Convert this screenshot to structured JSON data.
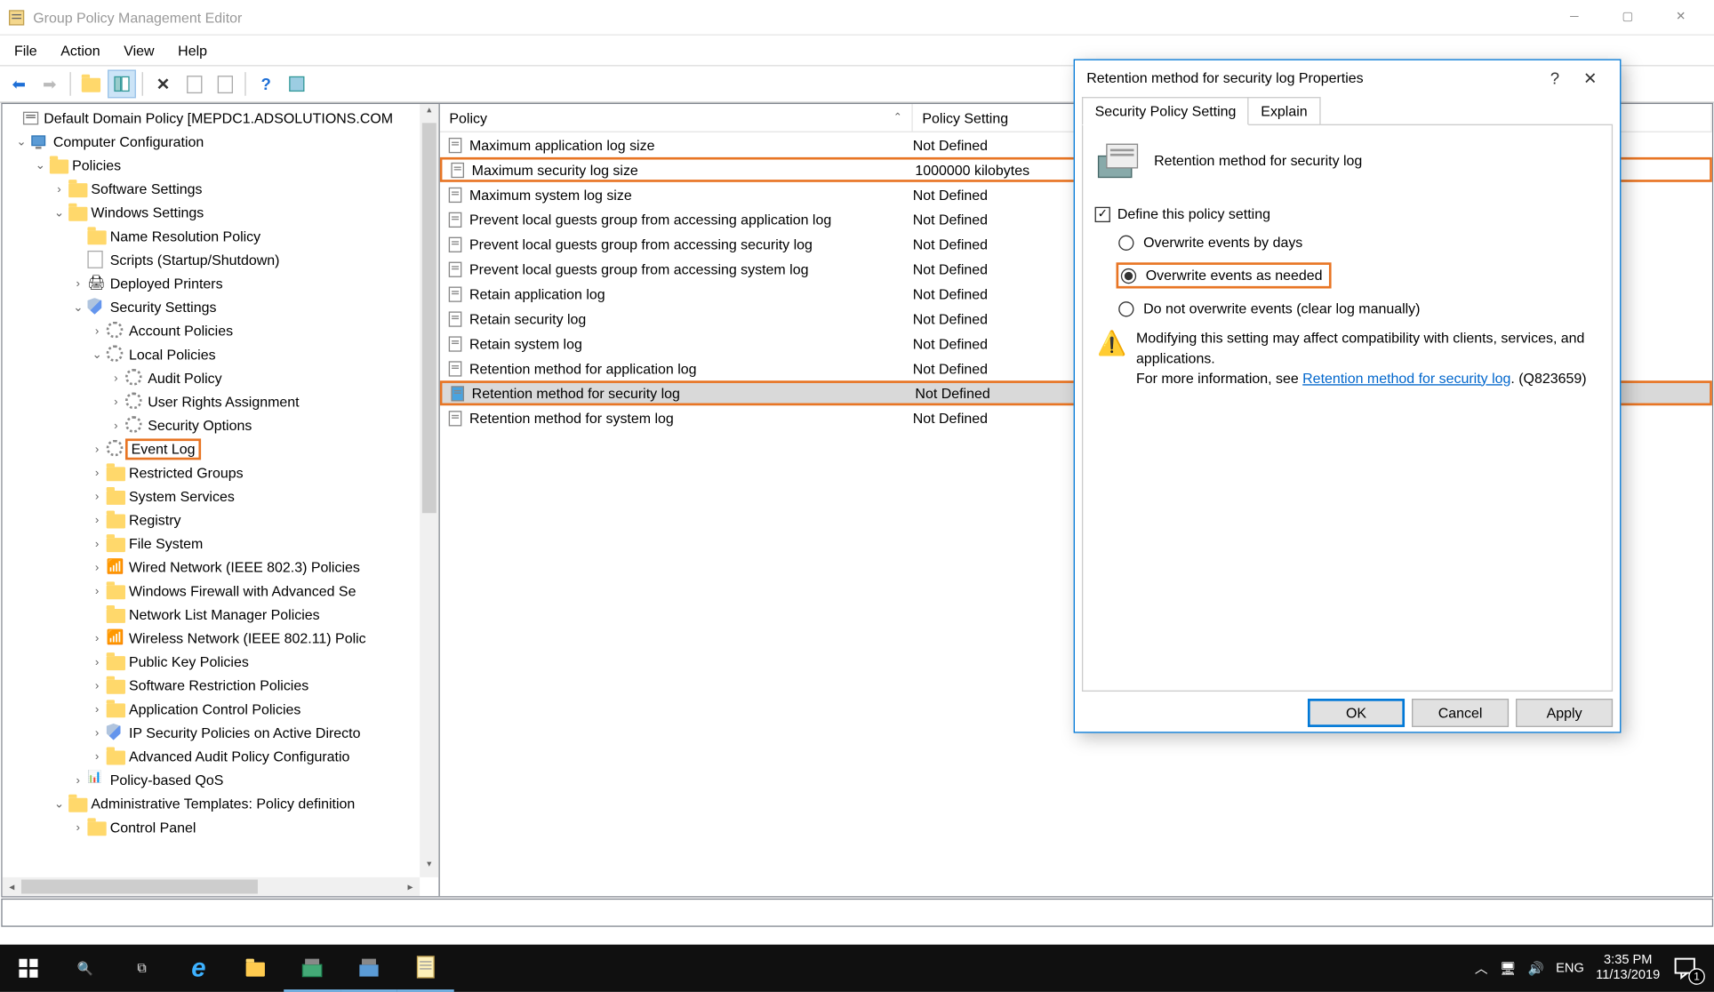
{
  "window": {
    "title": "Group Policy Management Editor",
    "menu": [
      "File",
      "Action",
      "View",
      "Help"
    ]
  },
  "tree": {
    "root": "Default Domain Policy [MEPDC1.ADSOLUTIONS.COM",
    "nodes": {
      "computer_config": "Computer Configuration",
      "policies": "Policies",
      "software_settings": "Software Settings",
      "windows_settings": "Windows Settings",
      "name_res": "Name Resolution Policy",
      "scripts": "Scripts (Startup/Shutdown)",
      "deployed_printers": "Deployed Printers",
      "security_settings": "Security Settings",
      "account_policies": "Account Policies",
      "local_policies": "Local Policies",
      "audit_policy": "Audit Policy",
      "user_rights": "User Rights Assignment",
      "security_options": "Security Options",
      "event_log": "Event Log",
      "restricted_groups": "Restricted Groups",
      "system_services": "System Services",
      "registry": "Registry",
      "file_system": "File System",
      "wired_network": "Wired Network (IEEE 802.3) Policies",
      "firewall": "Windows Firewall with Advanced Se",
      "netlist": "Network List Manager Policies",
      "wireless": "Wireless Network (IEEE 802.11) Polic",
      "pki": "Public Key Policies",
      "srp": "Software Restriction Policies",
      "appctrl": "Application Control Policies",
      "ipsec": "IP Security Policies on Active Directo",
      "adv_audit": "Advanced Audit Policy Configuratio",
      "qos": "Policy-based QoS",
      "admin_templates": "Administrative Templates: Policy definition",
      "control_panel": "Control Panel"
    }
  },
  "list": {
    "headers": {
      "policy": "Policy",
      "setting": "Policy Setting"
    },
    "rows": [
      {
        "name": "Maximum application log size",
        "setting": "Not Defined"
      },
      {
        "name": "Maximum security log size",
        "setting": "1000000 kilobytes",
        "hl": true
      },
      {
        "name": "Maximum system log size",
        "setting": "Not Defined"
      },
      {
        "name": "Prevent local guests group from accessing application log",
        "setting": "Not Defined"
      },
      {
        "name": "Prevent local guests group from accessing security log",
        "setting": "Not Defined"
      },
      {
        "name": "Prevent local guests group from accessing system log",
        "setting": "Not Defined"
      },
      {
        "name": "Retain application log",
        "setting": "Not Defined"
      },
      {
        "name": "Retain security log",
        "setting": "Not Defined"
      },
      {
        "name": "Retain system log",
        "setting": "Not Defined"
      },
      {
        "name": "Retention method for application log",
        "setting": "Not Defined"
      },
      {
        "name": "Retention method for security log",
        "setting": "Not Defined",
        "sel": true,
        "hl": true
      },
      {
        "name": "Retention method for system log",
        "setting": "Not Defined"
      }
    ]
  },
  "dialog": {
    "title": "Retention method for security log Properties",
    "tabs": {
      "main": "Security Policy Setting",
      "explain": "Explain"
    },
    "heading": "Retention method for security log",
    "define": "Define this policy setting",
    "radios": {
      "by_days": "Overwrite events by days",
      "as_needed": "Overwrite events as needed",
      "no_overwrite": "Do not overwrite events (clear log manually)"
    },
    "warning": {
      "line1": "Modifying this setting may affect compatibility with clients, services, and applications.",
      "line2a": "For more information, see ",
      "link": "Retention method for security log",
      "line2b": ". (Q823659)"
    },
    "buttons": {
      "ok": "OK",
      "cancel": "Cancel",
      "apply": "Apply"
    }
  },
  "taskbar": {
    "lang": "ENG",
    "time": "3:35 PM",
    "date": "11/13/2019",
    "notif_count": "1"
  }
}
